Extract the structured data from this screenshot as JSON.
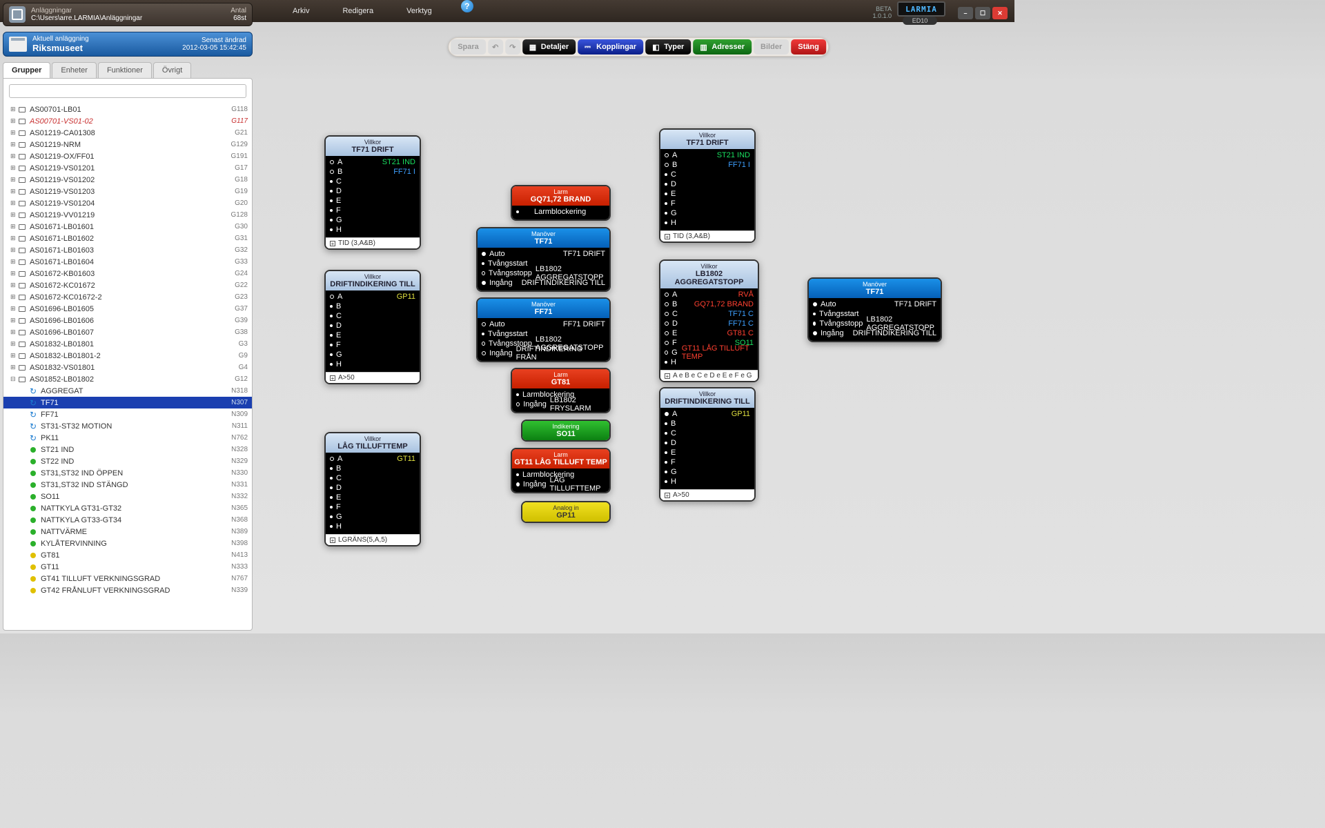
{
  "menu": {
    "arkiv": "Arkiv",
    "redigera": "Redigera",
    "verktyg": "Verktyg"
  },
  "brand": {
    "logo": "LARMIA",
    "ed": "ED10",
    "beta": "BETA",
    "ver": "1.0.1.0"
  },
  "paths": {
    "title": "Anläggningar",
    "path": "C:\\Users\\arre.LARMIA\\Anläggningar",
    "countLbl": "Antal",
    "count": "68st"
  },
  "facility": {
    "title": "Aktuell anläggning",
    "name": "Riksmuseet",
    "changedLbl": "Senast ändrad",
    "changed": "2012-03-05 15:42:45"
  },
  "tabs": [
    "Grupper",
    "Enheter",
    "Funktioner",
    "Övrigt"
  ],
  "toolbar": {
    "save": "Spara",
    "det": "Detaljer",
    "kop": "Kopplingar",
    "typ": "Typer",
    "adr": "Adresser",
    "bil": "Bilder",
    "close": "Stäng"
  },
  "tree": [
    {
      "t": "p",
      "l": "AS00701-LB01",
      "c": "G118"
    },
    {
      "t": "p",
      "l": "AS00701-VS01-02",
      "c": "G117",
      "red": true
    },
    {
      "t": "p",
      "l": "AS01219-CA01308",
      "c": "G21"
    },
    {
      "t": "p",
      "l": "AS01219-NRM",
      "c": "G129"
    },
    {
      "t": "p",
      "l": "AS01219-OX/FF01",
      "c": "G191"
    },
    {
      "t": "p",
      "l": "AS01219-VS01201",
      "c": "G17"
    },
    {
      "t": "p",
      "l": "AS01219-VS01202",
      "c": "G18"
    },
    {
      "t": "p",
      "l": "AS01219-VS01203",
      "c": "G19"
    },
    {
      "t": "p",
      "l": "AS01219-VS01204",
      "c": "G20"
    },
    {
      "t": "p",
      "l": "AS01219-VV01219",
      "c": "G128"
    },
    {
      "t": "p",
      "l": "AS01671-LB01601",
      "c": "G30"
    },
    {
      "t": "p",
      "l": "AS01671-LB01602",
      "c": "G31"
    },
    {
      "t": "p",
      "l": "AS01671-LB01603",
      "c": "G32"
    },
    {
      "t": "p",
      "l": "AS01671-LB01604",
      "c": "G33"
    },
    {
      "t": "p",
      "l": "AS01672-KB01603",
      "c": "G24"
    },
    {
      "t": "p",
      "l": "AS01672-KC01672",
      "c": "G22"
    },
    {
      "t": "p",
      "l": "AS01672-KC01672-2",
      "c": "G23"
    },
    {
      "t": "p",
      "l": "AS01696-LB01605",
      "c": "G37"
    },
    {
      "t": "p",
      "l": "AS01696-LB01606",
      "c": "G39"
    },
    {
      "t": "p",
      "l": "AS01696-LB01607",
      "c": "G38"
    },
    {
      "t": "p",
      "l": "AS01832-LB01801",
      "c": "G3"
    },
    {
      "t": "p",
      "l": "AS01832-LB01801-2",
      "c": "G9"
    },
    {
      "t": "p",
      "l": "AS01832-VS01801",
      "c": "G4"
    },
    {
      "t": "p",
      "l": "AS01852-LB01802",
      "c": "G12",
      "open": true
    },
    {
      "t": "c",
      "ic": "a",
      "l": "AGGREGAT",
      "c": "N318"
    },
    {
      "t": "c",
      "ic": "a",
      "l": "TF71",
      "c": "N307",
      "sel": true
    },
    {
      "t": "c",
      "ic": "a",
      "l": "FF71",
      "c": "N309"
    },
    {
      "t": "c",
      "ic": "a",
      "l": "ST31-ST32 MOTION",
      "c": "N311"
    },
    {
      "t": "c",
      "ic": "a",
      "l": "PK11",
      "c": "N762"
    },
    {
      "t": "c",
      "ic": "g",
      "l": "ST21 IND",
      "c": "N328"
    },
    {
      "t": "c",
      "ic": "g",
      "l": "ST22 IND",
      "c": "N329"
    },
    {
      "t": "c",
      "ic": "g",
      "l": "ST31,ST32 IND ÖPPEN",
      "c": "N330"
    },
    {
      "t": "c",
      "ic": "g",
      "l": "ST31,ST32 IND STÄNGD",
      "c": "N331"
    },
    {
      "t": "c",
      "ic": "g",
      "l": "SO11",
      "c": "N332"
    },
    {
      "t": "c",
      "ic": "g",
      "l": "NATTKYLA GT31-GT32",
      "c": "N365"
    },
    {
      "t": "c",
      "ic": "g",
      "l": "NATTKYLA GT33-GT34",
      "c": "N368"
    },
    {
      "t": "c",
      "ic": "g",
      "l": "NATTVÄRME",
      "c": "N389"
    },
    {
      "t": "c",
      "ic": "g",
      "l": "KYLÅTERVINNING",
      "c": "N398"
    },
    {
      "t": "c",
      "ic": "y",
      "l": "GT81",
      "c": "N413"
    },
    {
      "t": "c",
      "ic": "y",
      "l": "GT11",
      "c": "N333"
    },
    {
      "t": "c",
      "ic": "y",
      "l": "GT41 TILLUFT VERKNINGSGRAD",
      "c": "N767"
    },
    {
      "t": "c",
      "ic": "y",
      "l": "GT42 FRÅNLUFT VERKNINGSGRAD",
      "c": "N339"
    }
  ],
  "nodes": {
    "v_tf71": {
      "sub": "Villkor",
      "title": "TF71 DRIFT",
      "rows": [
        {
          "b": "ring",
          "k": "A",
          "v": "ST21 IND",
          "cls": "c-green"
        },
        {
          "b": "ring",
          "k": "B",
          "v": "FF71 I",
          "cls": "c-blue"
        },
        {
          "b": "dot",
          "k": "C"
        },
        {
          "b": "dot",
          "k": "D"
        },
        {
          "b": "dot",
          "k": "E"
        },
        {
          "b": "dot",
          "k": "F"
        },
        {
          "b": "dot",
          "k": "G"
        },
        {
          "b": "dot",
          "k": "H"
        }
      ],
      "foot": "TID (3,A&B)"
    },
    "v_drift": {
      "sub": "Villkor",
      "title": "DRIFTINDIKERING TILL",
      "rows": [
        {
          "b": "ring",
          "k": "A",
          "v": "GP11",
          "cls": "c-yellow"
        },
        {
          "b": "dot",
          "k": "B"
        },
        {
          "b": "dot",
          "k": "C"
        },
        {
          "b": "dot",
          "k": "D"
        },
        {
          "b": "dot",
          "k": "E"
        },
        {
          "b": "dot",
          "k": "F"
        },
        {
          "b": "dot",
          "k": "G"
        },
        {
          "b": "dot",
          "k": "H"
        }
      ],
      "foot": "A>50"
    },
    "v_lag": {
      "sub": "Villkor",
      "title": "LÅG TILLUFTTEMP",
      "rows": [
        {
          "b": "ring",
          "k": "A",
          "v": "GT11",
          "cls": "c-yellow"
        },
        {
          "b": "dot",
          "k": "B"
        },
        {
          "b": "dot",
          "k": "C"
        },
        {
          "b": "dot",
          "k": "D"
        },
        {
          "b": "dot",
          "k": "E"
        },
        {
          "b": "dot",
          "k": "F"
        },
        {
          "b": "dot",
          "k": "G"
        },
        {
          "b": "dot",
          "k": "H"
        }
      ],
      "foot": "LGRÄNS(5,A,5)"
    },
    "l_gq": {
      "sub": "Larm",
      "title": "GQ71,72 BRAND",
      "rows": [
        {
          "b": "dot",
          "k": "",
          "t": "Larmblockering"
        }
      ]
    },
    "m_tf71": {
      "sub": "Manöver",
      "title": "TF71",
      "rows": [
        {
          "b": "full",
          "t": "Auto",
          "v": "TF71 DRIFT"
        },
        {
          "b": "dot",
          "t": "Tvångsstart"
        },
        {
          "b": "ring",
          "t": "Tvångsstopp",
          "v": "LB1802 AGGREGATSTOPP"
        },
        {
          "b": "full",
          "t": "Ingång",
          "v": "DRIFTINDIKERING TILL"
        }
      ]
    },
    "m_ff71": {
      "sub": "Manöver",
      "title": "FF71",
      "rows": [
        {
          "b": "ring",
          "t": "Auto",
          "v": "FF71 DRIFT"
        },
        {
          "b": "dot",
          "t": "Tvångsstart"
        },
        {
          "b": "ring",
          "t": "Tvångsstopp",
          "v": "LB1802 AGGREGATSTOPP"
        },
        {
          "b": "ring",
          "t": "Ingång",
          "v": "DRIFTINDIKERING FRÅN"
        }
      ]
    },
    "l_gt81": {
      "sub": "Larm",
      "title": "GT81",
      "rows": [
        {
          "b": "dot",
          "t": "Larmblockering"
        },
        {
          "b": "ring",
          "t": "Ingång",
          "v": "LB1802 FRYSLARM"
        }
      ]
    },
    "i_so11": {
      "sub": "Indikering",
      "title": "SO11"
    },
    "l_gt11": {
      "sub": "Larm",
      "title": "GT11 LÅG TILLUFT TEMP",
      "rows": [
        {
          "b": "dot",
          "t": "Larmblockering"
        },
        {
          "b": "full",
          "t": "Ingång",
          "v": "LÅG TILLUFTTEMP"
        }
      ]
    },
    "a_gp11": {
      "sub": "Analog in",
      "title": "GP11"
    },
    "v_tf71b": {
      "sub": "Villkor",
      "title": "TF71 DRIFT",
      "rows": [
        {
          "b": "ring",
          "k": "A",
          "v": "ST21 IND",
          "cls": "c-green"
        },
        {
          "b": "ring",
          "k": "B",
          "v": "FF71 I",
          "cls": "c-blue"
        },
        {
          "b": "dot",
          "k": "C"
        },
        {
          "b": "dot",
          "k": "D"
        },
        {
          "b": "dot",
          "k": "E"
        },
        {
          "b": "dot",
          "k": "F"
        },
        {
          "b": "dot",
          "k": "G"
        },
        {
          "b": "dot",
          "k": "H"
        }
      ],
      "foot": "TID (3,A&B)"
    },
    "v_lb1802": {
      "sub": "Villkor",
      "title": "LB1802 AGGREGATSTOPP",
      "rows": [
        {
          "b": "ring",
          "k": "A",
          "v": "RVÅ",
          "cls": "c-red"
        },
        {
          "b": "ring",
          "k": "B",
          "v": "GQ71,72 BRAND",
          "cls": "c-red"
        },
        {
          "b": "ring",
          "k": "C",
          "v": "TF71 C",
          "cls": "c-blue"
        },
        {
          "b": "ring",
          "k": "D",
          "v": "FF71 C",
          "cls": "c-blue"
        },
        {
          "b": "ring",
          "k": "E",
          "v": "GT81 C",
          "cls": "c-red"
        },
        {
          "b": "ring",
          "k": "F",
          "v": "SO11",
          "cls": "c-green"
        },
        {
          "b": "ring",
          "k": "G",
          "v": "GT11 LÅG TILLUFT TEMP",
          "cls": "c-red"
        },
        {
          "b": "dot",
          "k": "H"
        }
      ],
      "foot": "A e B e C e D e E e F e G"
    },
    "v_driftb": {
      "sub": "Villkor",
      "title": "DRIFTINDIKERING TILL",
      "rows": [
        {
          "b": "full",
          "k": "A",
          "v": "GP11",
          "cls": "c-yellow"
        },
        {
          "b": "dot",
          "k": "B"
        },
        {
          "b": "dot",
          "k": "C"
        },
        {
          "b": "dot",
          "k": "D"
        },
        {
          "b": "dot",
          "k": "E"
        },
        {
          "b": "dot",
          "k": "F"
        },
        {
          "b": "dot",
          "k": "G"
        },
        {
          "b": "dot",
          "k": "H"
        }
      ],
      "foot": "A>50"
    },
    "m_tf71b": {
      "sub": "Manöver",
      "title": "TF71",
      "rows": [
        {
          "b": "full",
          "t": "Auto",
          "v": "TF71 DRIFT"
        },
        {
          "b": "dot",
          "t": "Tvångsstart"
        },
        {
          "b": "full",
          "t": "Tvångsstopp",
          "v": "LB1802 AGGREGATSTOPP"
        },
        {
          "b": "full",
          "t": "Ingång",
          "v": "DRIFTINDIKERING TILL"
        }
      ]
    }
  }
}
